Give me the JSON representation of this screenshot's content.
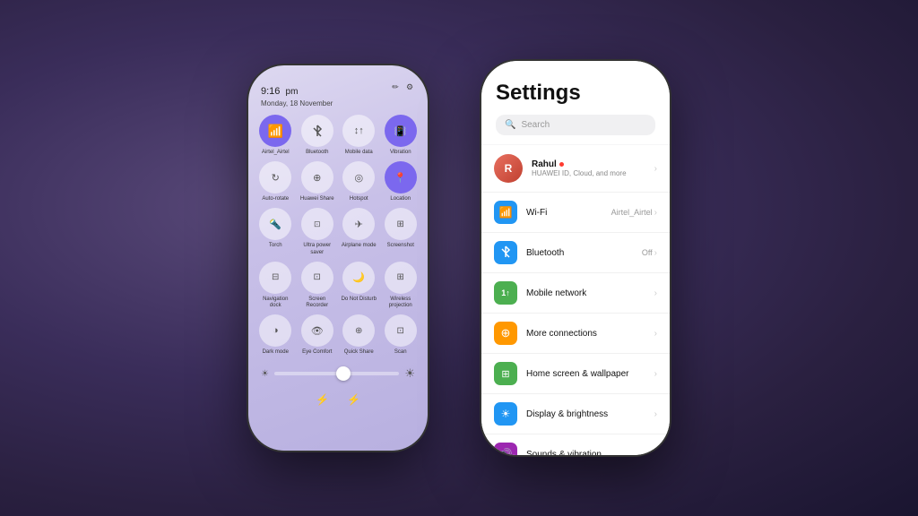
{
  "background": {
    "style": "dark purple gradient"
  },
  "left_phone": {
    "time": "9:16",
    "time_suffix": "pm",
    "date": "Monday, 18 November",
    "toggles": [
      {
        "id": "wifi",
        "label": "Airtel_Airtel",
        "active": true,
        "icon": "📶"
      },
      {
        "id": "bluetooth",
        "label": "Bluetooth",
        "active": false,
        "icon": "⚡"
      },
      {
        "id": "mobile_data",
        "label": "Mobile data",
        "active": false,
        "icon": "↕"
      },
      {
        "id": "vibration",
        "label": "Vibration",
        "active": true,
        "icon": "📳"
      },
      {
        "id": "auto_rotate",
        "label": "Auto-rotate",
        "active": false,
        "icon": "↻"
      },
      {
        "id": "huawei_share",
        "label": "Huawei Share",
        "active": false,
        "icon": "⊕"
      },
      {
        "id": "hotspot",
        "label": "Hotspot",
        "active": false,
        "icon": "◎"
      },
      {
        "id": "location",
        "label": "Location",
        "active": true,
        "icon": "📍"
      },
      {
        "id": "torch",
        "label": "Torch",
        "active": false,
        "icon": "🔦"
      },
      {
        "id": "ultra_power",
        "label": "Ultra power saver",
        "active": false,
        "icon": "⊡"
      },
      {
        "id": "airplane",
        "label": "Airplane mode",
        "active": false,
        "icon": "✈"
      },
      {
        "id": "screenshot",
        "label": "Screenshot",
        "active": false,
        "icon": "⊞"
      },
      {
        "id": "nav_dock",
        "label": "Navigation dock",
        "active": false,
        "icon": "⊟"
      },
      {
        "id": "screen_rec",
        "label": "Screen Recorder",
        "active": false,
        "icon": "⊡"
      },
      {
        "id": "do_not_disturb",
        "label": "Do Not Disturb",
        "active": false,
        "icon": "🌙"
      },
      {
        "id": "wireless_proj",
        "label": "Wireless projection",
        "active": false,
        "icon": "⊞"
      },
      {
        "id": "dark_mode",
        "label": "Dark mode",
        "active": false,
        "icon": "◑"
      },
      {
        "id": "eye_comfort",
        "label": "Eye Comfort",
        "active": false,
        "icon": "👁"
      },
      {
        "id": "quick_share",
        "label": "Quick Share",
        "active": false,
        "icon": "⊕"
      },
      {
        "id": "scan",
        "label": "Scan",
        "active": false,
        "icon": "⊡"
      }
    ],
    "brightness": 0.55
  },
  "right_phone": {
    "title": "Settings",
    "search_placeholder": "Search",
    "profile": {
      "name": "Rahul",
      "subtitle": "HUAWEI ID, Cloud, and more"
    },
    "menu_items": [
      {
        "id": "wifi",
        "label": "Wi-Fi",
        "value": "Airtel_Airtel",
        "icon_color": "#2196F3",
        "icon": "📶"
      },
      {
        "id": "bluetooth",
        "label": "Bluetooth",
        "value": "Off",
        "icon_color": "#2196F3",
        "icon": "⚡"
      },
      {
        "id": "mobile_network",
        "label": "Mobile network",
        "value": "",
        "icon_color": "#4CAF50",
        "icon": "1↑"
      },
      {
        "id": "more_connections",
        "label": "More connections",
        "value": "",
        "icon_color": "#FF9800",
        "icon": "⊕"
      },
      {
        "id": "home_screen",
        "label": "Home screen & wallpaper",
        "value": "",
        "icon_color": "#4CAF50",
        "icon": "⊞"
      },
      {
        "id": "display",
        "label": "Display & brightness",
        "value": "",
        "icon_color": "#2196F3",
        "icon": "☀"
      },
      {
        "id": "sounds",
        "label": "Sounds & vibration",
        "value": "",
        "icon_color": "#9C27B0",
        "icon": "🔊"
      }
    ]
  }
}
